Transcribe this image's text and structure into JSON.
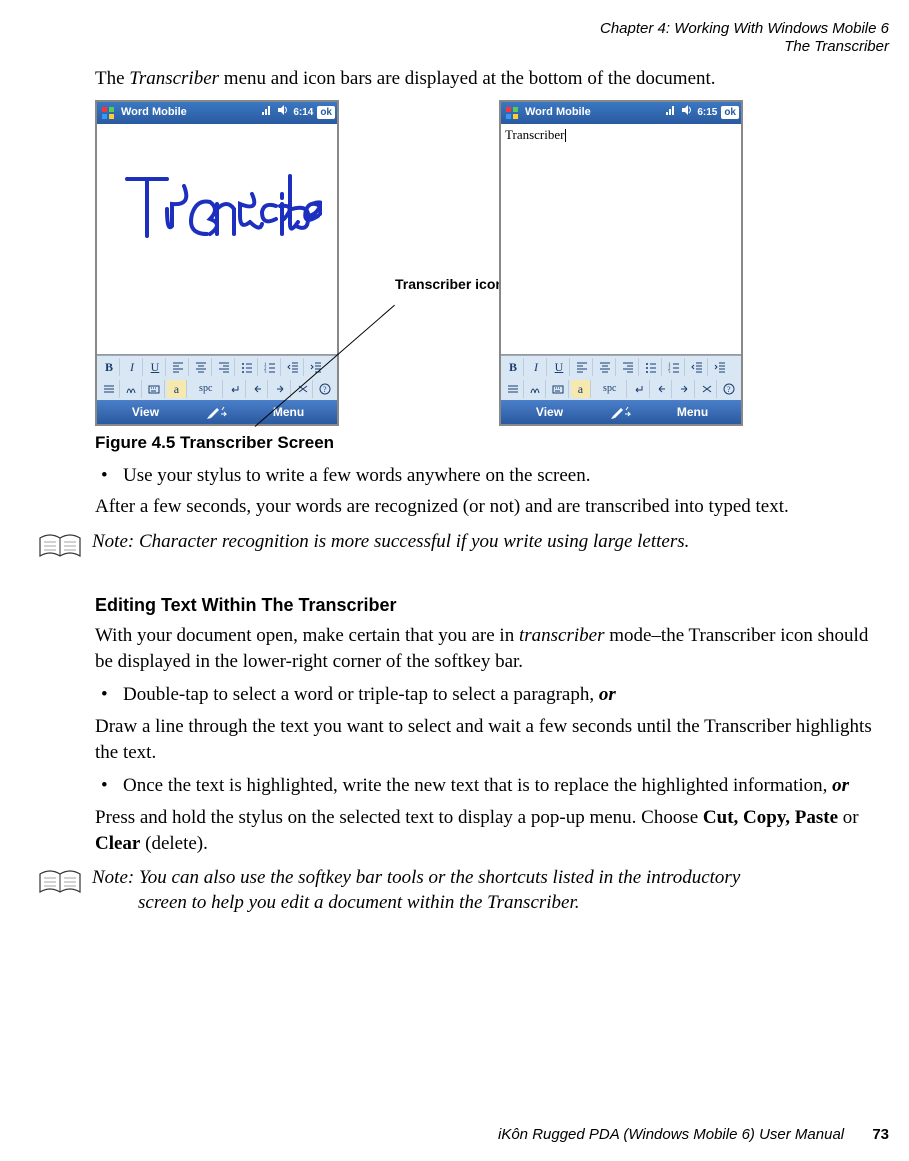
{
  "header": {
    "chapter_line": "Chapter 4: Working With Windows Mobile 6",
    "section_line": "The Transcriber"
  },
  "intro_pre": "The ",
  "intro_em": "Transcriber",
  "intro_post": " menu and icon bars are displayed at the bottom of the document.",
  "callout_label": "Transcriber icon",
  "phone_left": {
    "app_title": "Word Mobile",
    "time": "6:14",
    "ok": "ok",
    "soft_left": "View",
    "soft_right": "Menu",
    "row2_spc": "spc",
    "row2_a": "a"
  },
  "phone_right": {
    "app_title": "Word Mobile",
    "time": "6:15",
    "ok": "ok",
    "typed_text": "Transcriber",
    "soft_left": "View",
    "soft_right": "Menu",
    "row2_spc": "spc",
    "row2_a": "a"
  },
  "figure_caption": "Figure 4.5  Transcriber Screen",
  "bullet1": "Use your stylus to write a few words anywhere on the screen.",
  "after_bullet1": "After a few seconds, your words are recognized (or not) and are transcribed into typed text.",
  "note1_label": "Note:",
  "note1_text": " Character recognition is more successful if you write using large letters.",
  "subhead": "Editing Text Within The Transcriber",
  "p_edit_pre": "With your document open, make certain that you are in ",
  "p_edit_em": "transcriber",
  "p_edit_post": " mode–the Transcriber icon should be displayed in the lower-right corner of the softkey bar.",
  "bullet2_pre": "Double-tap to select a word or triple-tap to select a paragraph, ",
  "bullet2_or": "or",
  "after_bullet2": "Draw a line through the text you want to select and wait a few seconds until the Transcriber highlights the text.",
  "bullet3_pre": "Once the text is highlighted, write the new text that is to replace the highlighted information, ",
  "bullet3_or": "or",
  "after_bullet3_pre": "Press and hold the stylus on the selected text to display a pop-up menu. Choose ",
  "after_bullet3_b1": "Cut, Copy, Paste",
  "after_bullet3_mid": " or ",
  "after_bullet3_b2": "Clear",
  "after_bullet3_post": " (delete).",
  "note2_label": "Note:",
  "note2_line1": " You can also use the softkey bar tools or the shortcuts listed in the introductory ",
  "note2_line2": "screen to help you edit a document within the Transcriber.",
  "footer": {
    "title": "iKôn Rugged PDA (Windows Mobile 6) User Manual",
    "page": "73"
  },
  "toolbar_labels": {
    "bold": "B",
    "italic": "I",
    "underline": "U"
  }
}
